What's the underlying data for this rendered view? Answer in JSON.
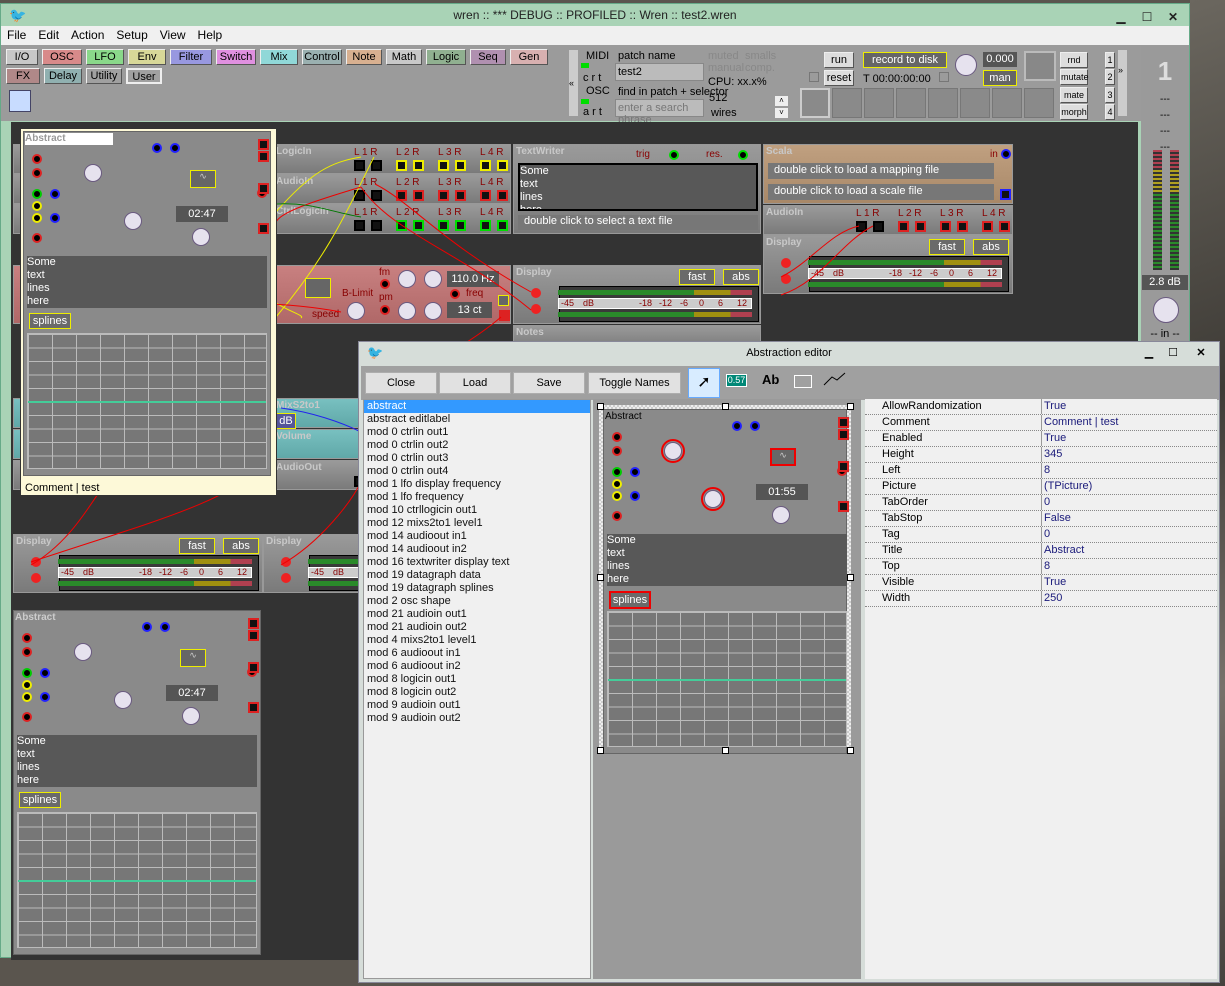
{
  "window": {
    "title": "wren  ::  *** DEBUG  ::  PROFILED  ::  Wren  ::  test2.wren"
  },
  "menu": [
    "File",
    "Edit",
    "Action",
    "Setup",
    "View",
    "Help"
  ],
  "categories_row1": [
    {
      "label": "I/O",
      "color": "#c8c8c8"
    },
    {
      "label": "OSC",
      "color": "#d88a8a"
    },
    {
      "label": "LFO",
      "color": "#8ad88a"
    },
    {
      "label": "Env",
      "color": "#d8d898"
    },
    {
      "label": "Filter",
      "color": "#9898e0"
    },
    {
      "label": "Switch",
      "color": "#e090e0"
    },
    {
      "label": "Mix",
      "color": "#90d8d8"
    },
    {
      "label": "Control",
      "color": "#9ab0b0"
    },
    {
      "label": "Note",
      "color": "#d8b090"
    },
    {
      "label": "Math",
      "color": "#c8c8c8"
    },
    {
      "label": "Logic",
      "color": "#90b090"
    },
    {
      "label": "Seq",
      "color": "#b090b0"
    },
    {
      "label": "Gen",
      "color": "#d8b0b0"
    }
  ],
  "categories_row2": [
    {
      "label": "FX",
      "color": "#b08888"
    },
    {
      "label": "Delay",
      "color": "#90b0b0"
    },
    {
      "label": "Utility",
      "color": "#a0a0a0"
    },
    {
      "label": "User",
      "color": "#a0a0a0"
    }
  ],
  "control": {
    "midi": "MIDI",
    "crt": "c  r  t",
    "osc": "OSC",
    "art": "a  r  t",
    "patch_name_label": "patch name",
    "patch_name": "test2",
    "find_label": "find in patch + selector",
    "search_placeholder": "enter a search phrase",
    "muted": "muted",
    "smalls": "smalls",
    "manual": "manual",
    "comp": "comp.",
    "cpu": "CPU: xx.x%",
    "wires_count": "512",
    "wires": "wires",
    "run": "run",
    "reset": "reset",
    "record": "record to disk",
    "time": "T 00:00:00:00",
    "value": "0.000",
    "man": "man",
    "rnd": "rnd",
    "mutate": "mutate",
    "mate": "mate",
    "morph": "morph",
    "pages": [
      "1",
      "2",
      "3",
      "4"
    ],
    "collapse_left": "«",
    "collapse_right": "»"
  },
  "vu_panel": {
    "number": "1",
    "dashes": [
      "---",
      "---",
      "---",
      "---"
    ],
    "level": "2.8 dB",
    "in_label": "-- in --"
  },
  "modules": {
    "logicin": {
      "title": "LogicIn",
      "ports": [
        "L 1 R",
        "L 2 R",
        "L 3 R",
        "L 4 R"
      ]
    },
    "audioin1": {
      "title": "AudioIn",
      "ports": [
        "L 1 R",
        "L 2 R",
        "L 3 R",
        "L 4 R"
      ]
    },
    "ctrllogicin": {
      "title": "CtrlLogicIn",
      "ports": [
        "L 1 R",
        "L 2 R",
        "L 3 R",
        "L 4 R"
      ]
    },
    "textwriter": {
      "title": "TextWriter",
      "trig": "trig",
      "res": "res.",
      "lines": [
        "Some",
        "text",
        "lines",
        "here"
      ],
      "file": "double click to select a text file"
    },
    "scala": {
      "title": "Scala",
      "in": "in",
      "mapping": "double click to load a mapping file",
      "scale": "double click to load a scale file"
    },
    "audioin2": {
      "title": "AudioIn",
      "ports": [
        "L 1 R",
        "L 2 R",
        "L 3 R",
        "L 4 R"
      ]
    },
    "osc": {
      "fm": "fm",
      "pm": "pm",
      "blimit": "B-Limit",
      "freq": "freq",
      "speed": "speed",
      "hz": "110.0 Hz",
      "ct": "13 ct"
    },
    "notes": {
      "title": "Notes"
    },
    "mix": {
      "title": "MixS2to1",
      "db": "dB"
    },
    "volume": {
      "title": "Volume"
    },
    "audioout": {
      "title": "AudioOut"
    }
  },
  "display": {
    "title": "Display",
    "fast": "fast",
    "abs": "abs",
    "scale": [
      "-45",
      "dB",
      "-18",
      "-12",
      "-6",
      "0",
      "6",
      "12"
    ]
  },
  "abstract_popup": {
    "title": "Abstract",
    "time": "02:47",
    "lines": [
      "Some",
      "text",
      "lines",
      "here"
    ],
    "splines": "splines",
    "comment": "Comment | test"
  },
  "abstract_bottom": {
    "title": "Abstract",
    "time": "02:47",
    "lines": [
      "Some",
      "text",
      "lines",
      "here"
    ],
    "splines": "splines"
  },
  "editor": {
    "title": "Abstraction editor",
    "buttons": [
      "Close",
      "Load",
      "Save",
      "Toggle Names"
    ],
    "num_tool": "0.57",
    "text_tool": "Ab",
    "list": [
      "abstract",
      "abstract editlabel",
      "mod 0 ctrlin out1",
      "mod 0 ctrlin out2",
      "mod 0 ctrlin out3",
      "mod 0 ctrlin out4",
      "mod 1 lfo display frequency",
      "mod 1 lfo frequency",
      "mod 10 ctrllogicin out1",
      "mod 12 mixs2to1 level1",
      "mod 14 audioout in1",
      "mod 14 audioout in2",
      "mod 16 textwriter display text",
      "mod 19 datagraph data",
      "mod 19 datagraph splines",
      "mod 2 osc shape",
      "mod 21 audioin out1",
      "mod 21 audioin out2",
      "mod 4 mixs2to1 level1",
      "mod 6 audioout in1",
      "mod 6 audioout in2",
      "mod 8 logicin out1",
      "mod 8 logicin out2",
      "mod 9 audioin out1",
      "mod 9 audioin out2"
    ],
    "selected": 0,
    "preview": {
      "title": "Abstract",
      "time": "01:55",
      "lines": [
        "Some",
        "text",
        "lines",
        "here"
      ],
      "splines": "splines"
    },
    "properties": [
      [
        "AllowRandomization",
        "True"
      ],
      [
        "Comment",
        "Comment | test"
      ],
      [
        "Enabled",
        "True"
      ],
      [
        "Height",
        "345"
      ],
      [
        "Left",
        "8"
      ],
      [
        "Picture",
        "(TPicture)"
      ],
      [
        "TabOrder",
        "0"
      ],
      [
        "TabStop",
        "False"
      ],
      [
        "Tag",
        "0"
      ],
      [
        "Title",
        "Abstract"
      ],
      [
        "Top",
        "8"
      ],
      [
        "Visible",
        "True"
      ],
      [
        "Width",
        "250"
      ]
    ]
  }
}
